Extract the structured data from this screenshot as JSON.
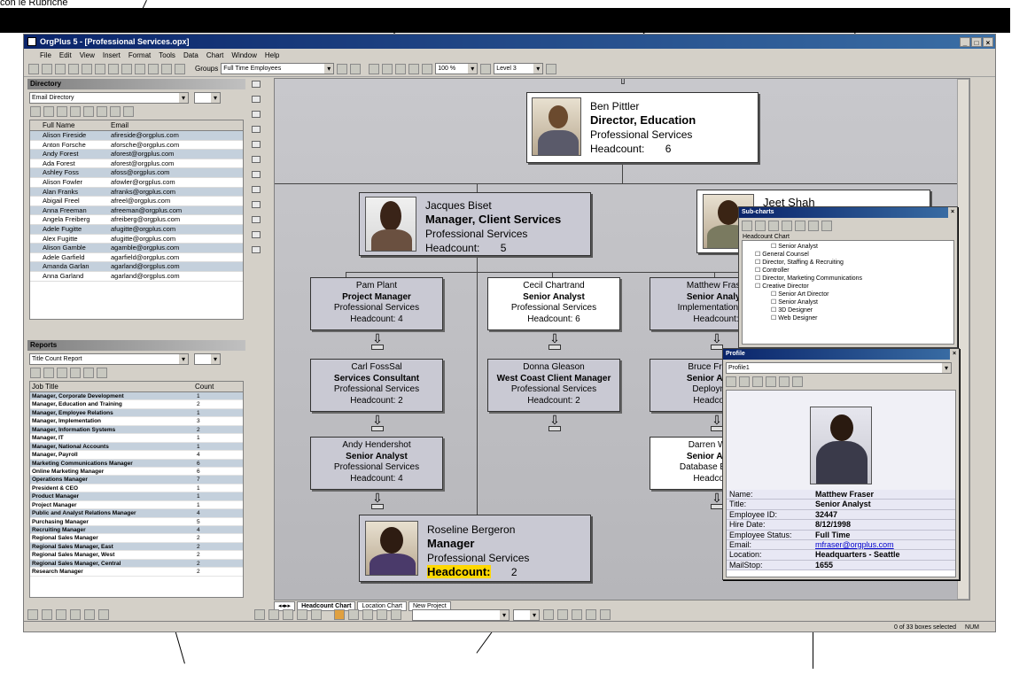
{
  "caption": {
    "top_left": "con le Rubriche"
  },
  "app": {
    "title": "OrgPlus 5 - [Professional Services.opx]",
    "min": "_",
    "max": "□",
    "close": "×"
  },
  "menu": [
    "File",
    "Edit",
    "View",
    "Insert",
    "Format",
    "Tools",
    "Data",
    "Chart",
    "Window",
    "Help"
  ],
  "toolbar": {
    "groups_label": "Groups",
    "groups_value": "Full Time Employees",
    "zoom_value": "100 %",
    "level_value": "Level 3"
  },
  "directory": {
    "title": "Directory",
    "combo": "Email Directory",
    "col_name": "Full Name",
    "col_email": "Email",
    "rows": [
      [
        "Alison Fireside",
        "afireside@orgplus.com"
      ],
      [
        "Anton Forsche",
        "aforsche@orgplus.com"
      ],
      [
        "Andy Forest",
        "aforest@orgplus.com"
      ],
      [
        "Ada Forest",
        "aforest@orgplus.com"
      ],
      [
        "Ashley Foss",
        "afoss@orgplus.com"
      ],
      [
        "Alison Fowler",
        "afowler@orgplus.com"
      ],
      [
        "Alan Franks",
        "afranks@orgplus.com"
      ],
      [
        "Abigail Freel",
        "afreel@orgplus.com"
      ],
      [
        "Anna Freeman",
        "afreeman@orgplus.com"
      ],
      [
        "Angela Freiberg",
        "afreiberg@orgplus.com"
      ],
      [
        "Adele Fugitte",
        "afugitte@orgplus.com"
      ],
      [
        "Alex Fugitte",
        "afugitte@orgplus.com"
      ],
      [
        "Alison Gamble",
        "agamble@orgplus.com"
      ],
      [
        "Adele Garfield",
        "agarfield@orgplus.com"
      ],
      [
        "Amanda Garlan",
        "agarland@orgplus.com"
      ],
      [
        "Anna Garland",
        "agarland@orgplus.com"
      ]
    ]
  },
  "reports": {
    "title": "Reports",
    "combo": "Title Count Report",
    "col_title": "Job Title",
    "col_count": "Count",
    "rows": [
      [
        "Manager, Corporate Development",
        "1"
      ],
      [
        "Manager, Education and Training",
        "2"
      ],
      [
        "Manager, Employee Relations",
        "1"
      ],
      [
        "Manager, Implementation",
        "3"
      ],
      [
        "Manager, Information Systems",
        "2"
      ],
      [
        "Manager, IT",
        "1"
      ],
      [
        "Manager, National Accounts",
        "1"
      ],
      [
        "Manager, Payroll",
        "4"
      ],
      [
        "Marketing Communications Manager",
        "6"
      ],
      [
        "Online Marketing Manager",
        "6"
      ],
      [
        "Operations Manager",
        "7"
      ],
      [
        "President & CEO",
        "1"
      ],
      [
        "Product Manager",
        "1"
      ],
      [
        "Project Manager",
        "1"
      ],
      [
        "Public and Analyst Relations Manager",
        "4"
      ],
      [
        "Purchasing Manager",
        "5"
      ],
      [
        "Recruiting Manager",
        "4"
      ],
      [
        "Regional Sales Manager",
        "2"
      ],
      [
        "Regional Sales Manager, East",
        "2"
      ],
      [
        "Regional Sales Manager, West",
        "2"
      ],
      [
        "Regional Sales Manager, Central",
        "2"
      ],
      [
        "Research Manager",
        "2"
      ]
    ]
  },
  "chart": {
    "ben": {
      "name": "Ben Pittler",
      "title": "Director, Education",
      "dept": "Professional Services",
      "hc_label": "Headcount:",
      "hc": "6"
    },
    "jacques": {
      "name": "Jacques Biset",
      "title": "Manager, Client Services",
      "dept": "Professional Services",
      "hc_label": "Headcount:",
      "hc": "5"
    },
    "jeet": {
      "name": "Jeet Shah"
    },
    "roseline": {
      "name": "Roseline Bergeron",
      "title": "Manager",
      "dept": "Professional Services",
      "hc_label": "Headcount:",
      "hc": "2"
    },
    "boxes": [
      {
        "name": "Pam Plant",
        "title": "Project Manager",
        "dept": "Professional Services",
        "hc": "Headcount:    4"
      },
      {
        "name": "Cecil Chartrand",
        "title": "Senior Analyst",
        "dept": "Professional Services",
        "hc": "Headcount:    6"
      },
      {
        "name": "Matthew Frase",
        "title": "Senior Analys",
        "dept": "Implementation Ser",
        "hc": "Headcount:"
      },
      {
        "name": "Carl FossSal",
        "title": "Services Consultant",
        "dept": "Professional Services",
        "hc": "Headcount:    2"
      },
      {
        "name": "Donna Gleason",
        "title": "West Coast Client Manager",
        "dept": "Professional Services",
        "hc": "Headcount:    2"
      },
      {
        "name": "Bruce Freema",
        "title": "Senior Analys",
        "dept": "Deployment",
        "hc": "Headcount:"
      },
      {
        "name": "Andy Hendershot",
        "title": "Senior Analyst",
        "dept": "Professional Services",
        "hc": "Headcount:    4"
      },
      {
        "name": "Darren Weber",
        "title": "Senior Analys",
        "dept": "Database Enginee",
        "hc": "Headcount:"
      }
    ]
  },
  "subcharts": {
    "title": "Sub-charts",
    "root": "Headcount Chart",
    "items": [
      "Senior Analyst",
      "General Counsel",
      "Director, Staffing & Recruiting",
      "Controller",
      "Director, Marketing Communications",
      "Creative Director",
      "Senior Art Director",
      "Senior Analyst",
      "3D Designer",
      "Web Designer"
    ]
  },
  "profile": {
    "title": "Profile",
    "combo": "Profile1",
    "fields": [
      [
        "Name:",
        "Matthew Fraser"
      ],
      [
        "Title:",
        "Senior Analyst"
      ],
      [
        "Employee ID:",
        "32447"
      ],
      [
        "Hire Date:",
        "8/12/1998"
      ],
      [
        "Employee Status:",
        "Full Time"
      ],
      [
        "Email:",
        "mfraser@orgplus.com"
      ],
      [
        "Location:",
        "Headquarters - Seattle"
      ],
      [
        "MailStop:",
        "1655"
      ]
    ]
  },
  "tabs": [
    "Headcount Chart",
    "Location Chart",
    "New Project"
  ],
  "status": {
    "selected": "0 of 33 boxes selected",
    "num": "NUM"
  }
}
